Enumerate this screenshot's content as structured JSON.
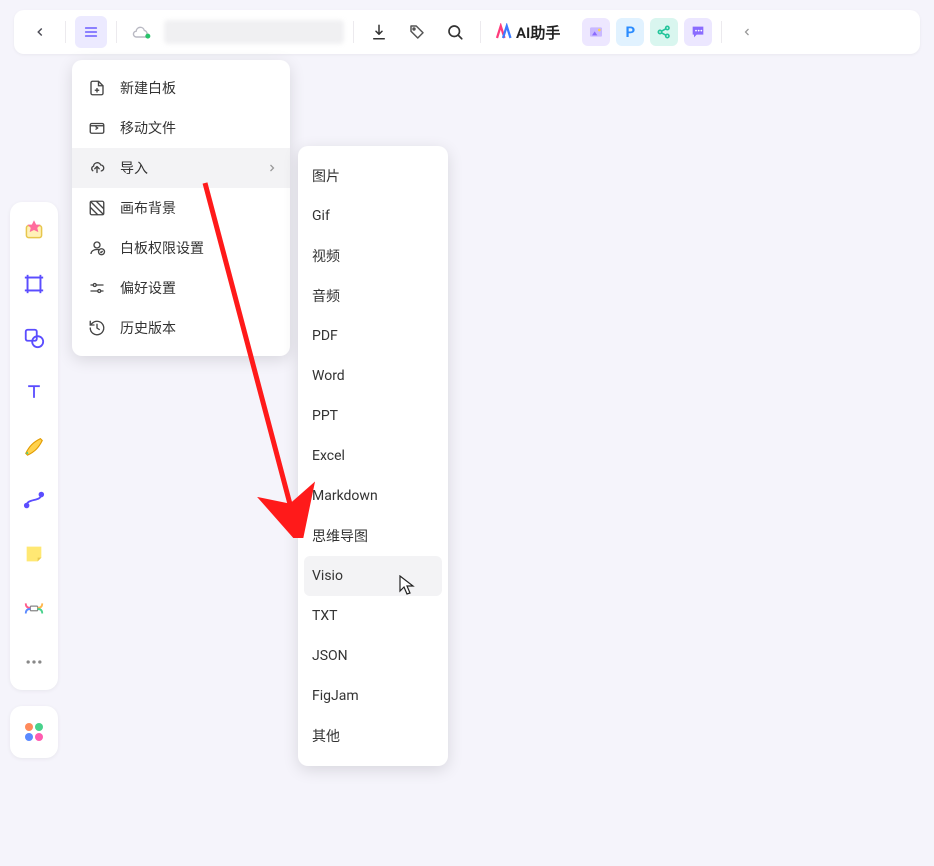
{
  "toolbar": {
    "ai_label": "AI助手"
  },
  "menu": {
    "items": [
      {
        "label": "新建白板"
      },
      {
        "label": "移动文件"
      },
      {
        "label": "导入"
      },
      {
        "label": "画布背景"
      },
      {
        "label": "白板权限设置"
      },
      {
        "label": "偏好设置"
      },
      {
        "label": "历史版本"
      }
    ]
  },
  "submenu": {
    "items": [
      {
        "label": "图片"
      },
      {
        "label": "Gif"
      },
      {
        "label": "视频"
      },
      {
        "label": "音频"
      },
      {
        "label": "PDF"
      },
      {
        "label": "Word"
      },
      {
        "label": "PPT"
      },
      {
        "label": "Excel"
      },
      {
        "label": "Markdown"
      },
      {
        "label": "思维导图"
      },
      {
        "label": "Visio"
      },
      {
        "label": "TXT"
      },
      {
        "label": "JSON"
      },
      {
        "label": "FigJam"
      },
      {
        "label": "其他"
      }
    ]
  },
  "quick": {
    "p": "P"
  }
}
